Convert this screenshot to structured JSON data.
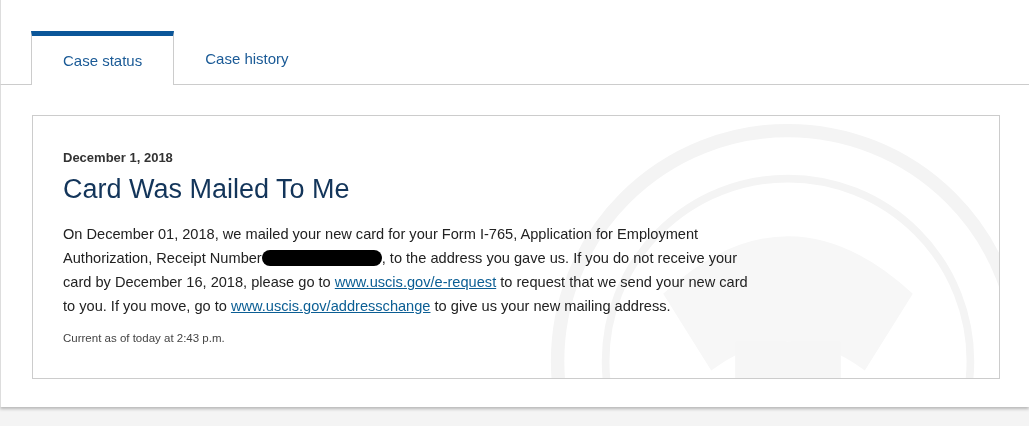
{
  "tabs": [
    {
      "label": "Case status",
      "selected": true
    },
    {
      "label": "Case history",
      "selected": false
    }
  ],
  "case": {
    "date": "December 1, 2018",
    "title": "Card Was Mailed To Me",
    "body": [
      {
        "kind": "text",
        "text": "On December 01, 2018, we mailed your new card for your Form I-765, Application for Employment Authorization, Receipt Number"
      },
      {
        "kind": "redaction"
      },
      {
        "kind": "text",
        "text": ", to the address you gave us. If you do not receive your card by December 16, 2018, please go to "
      },
      {
        "kind": "link",
        "text": "www.uscis.gov/e-request"
      },
      {
        "kind": "text",
        "text": " to request that we send your new card to you. If you move, go to "
      },
      {
        "kind": "link",
        "text": "www.uscis.gov/addresschange"
      },
      {
        "kind": "text",
        "text": " to give us your new mailing address."
      }
    ],
    "updated": "Current as of today at 2:43 p.m."
  }
}
